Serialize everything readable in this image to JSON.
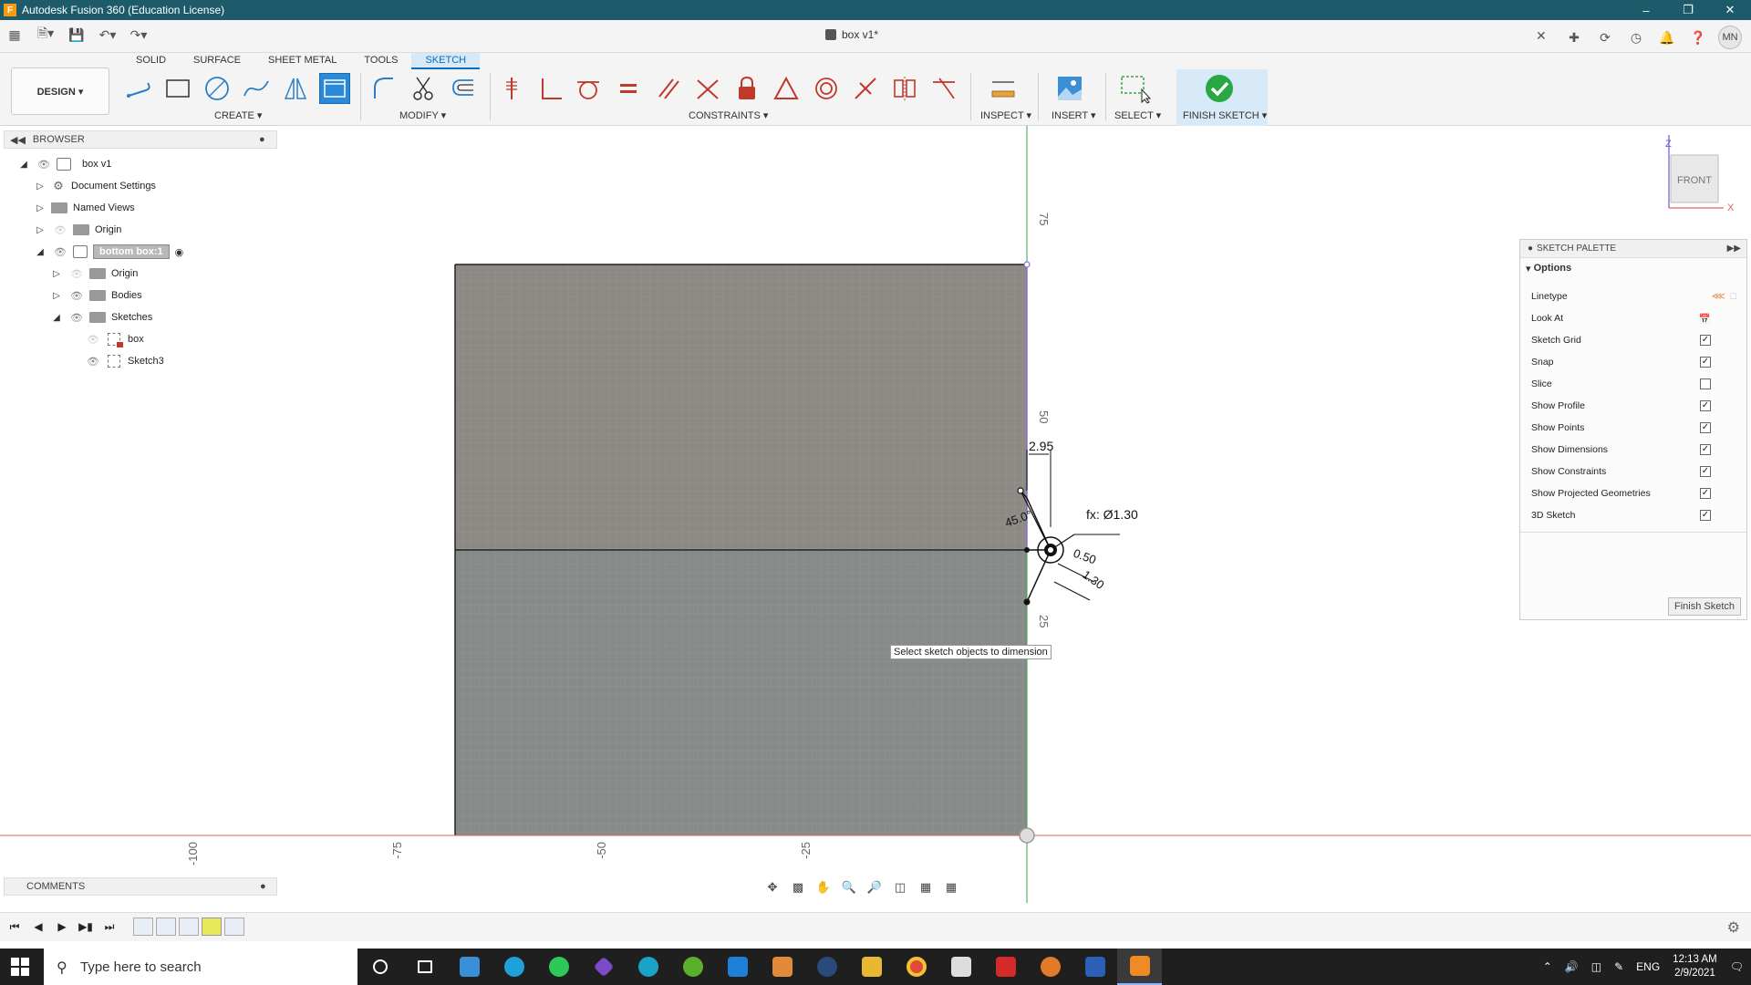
{
  "window": {
    "title": "Autodesk Fusion 360 (Education License)",
    "app_icon": "F"
  },
  "appbar": {
    "doc_title": "box v1*",
    "user_initials": "MN"
  },
  "ribbon": {
    "tabs": [
      "SOLID",
      "SURFACE",
      "SHEET METAL",
      "TOOLS",
      "SKETCH"
    ],
    "active_tab": "SKETCH",
    "workspace": "DESIGN ▾",
    "groups": {
      "create": "CREATE ▾",
      "modify": "MODIFY ▾",
      "constraints": "CONSTRAINTS ▾",
      "inspect": "INSPECT ▾",
      "insert": "INSERT ▾",
      "select": "SELECT ▾",
      "finish": "FINISH SKETCH ▾"
    }
  },
  "browser": {
    "title": "BROWSER",
    "items": {
      "root": "box v1",
      "doc_settings": "Document Settings",
      "named_views": "Named Views",
      "origin": "Origin",
      "component": "bottom box:1",
      "comp_origin": "Origin",
      "bodies": "Bodies",
      "sketches": "Sketches",
      "sketch_box": "box",
      "sketch3": "Sketch3"
    }
  },
  "canvas": {
    "ruler_v": [
      "75",
      "50",
      "25"
    ],
    "ruler_h": [
      "-100",
      "-75",
      "-50",
      "-25"
    ],
    "dims": {
      "d1": "2.95",
      "d2": "fx: Ø1.30",
      "d3": "45.0°",
      "d4": "0.50",
      "d5": "1.30"
    },
    "tooltip": "Select sketch objects to dimension",
    "viewcube": {
      "face": "FRONT",
      "z": "Z",
      "x": "X"
    }
  },
  "palette": {
    "title": "SKETCH PALETTE",
    "section": "Options",
    "rows": {
      "linetype": "Linetype",
      "lookat": "Look At",
      "grid": "Sketch Grid",
      "snap": "Snap",
      "slice": "Slice",
      "profile": "Show Profile",
      "points": "Show Points",
      "dimensions": "Show Dimensions",
      "constraints": "Show Constraints",
      "projected": "Show Projected Geometries",
      "sketch3d": "3D Sketch"
    },
    "finish_button": "Finish Sketch"
  },
  "comments": {
    "label": "COMMENTS"
  },
  "taskbar": {
    "search_placeholder": "Type here to search",
    "lang": "ENG",
    "time": "12:13 AM",
    "date": "2/9/2021"
  },
  "colors": {
    "titlebar": "#1d5b6b",
    "accent": "#0a6ebd",
    "face_top": "#8c8a86",
    "face_bottom": "#858a8a"
  }
}
